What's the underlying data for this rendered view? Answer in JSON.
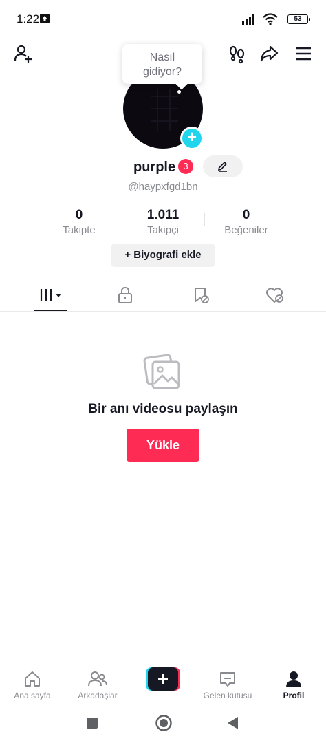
{
  "status_bar": {
    "time": "1:22",
    "battery": "53"
  },
  "tooltip": {
    "text_line1": "Nasıl",
    "text_line2": "gidiyor?"
  },
  "profile": {
    "username": "purple",
    "badge_count": "3",
    "handle": "@haypxfgd1bn",
    "stats": [
      {
        "value": "0",
        "label": "Takipte"
      },
      {
        "value": "1.011",
        "label": "Takipçi"
      },
      {
        "value": "0",
        "label": "Beğeniler"
      }
    ],
    "bio_button": "+ Biyografi ekle"
  },
  "empty_state": {
    "title": "Bir anı videosu paylaşın",
    "upload_label": "Yükle"
  },
  "bottom_nav": [
    {
      "label": "Ana sayfa"
    },
    {
      "label": "Arkadaşlar"
    },
    {
      "label": "Gelen kutusu"
    },
    {
      "label": "Profil"
    }
  ],
  "colors": {
    "accent": "#fe2c55",
    "cyan": "#20d5ec",
    "text": "#161823",
    "muted": "#8a8b91"
  }
}
